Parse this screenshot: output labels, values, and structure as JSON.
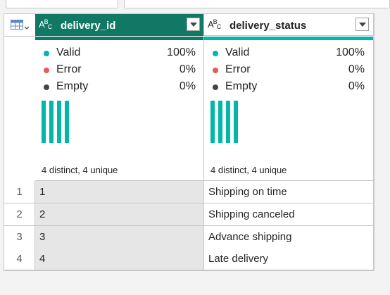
{
  "columns": [
    {
      "name": "delivery_id",
      "type_icon": "text-type-icon",
      "selected": true,
      "quality": {
        "valid_label": "Valid",
        "valid_value": "100%",
        "error_label": "Error",
        "error_value": "0%",
        "empty_label": "Empty",
        "empty_value": "0%"
      },
      "distinct_text": "4 distinct, 4 unique"
    },
    {
      "name": "delivery_status",
      "type_icon": "text-type-icon",
      "selected": false,
      "quality": {
        "valid_label": "Valid",
        "valid_value": "100%",
        "error_label": "Error",
        "error_value": "0%",
        "empty_label": "Empty",
        "empty_value": "0%"
      },
      "distinct_text": "4 distinct, 4 unique"
    }
  ],
  "rows": [
    {
      "num": "1",
      "delivery_id": "1",
      "delivery_status": "Shipping on time"
    },
    {
      "num": "2",
      "delivery_id": "2",
      "delivery_status": "Shipping canceled"
    },
    {
      "num": "3",
      "delivery_id": "3",
      "delivery_status": "Advance shipping"
    },
    {
      "num": "4",
      "delivery_id": "4",
      "delivery_status": "Late delivery"
    }
  ],
  "colors": {
    "selected_header": "#117865",
    "accent_teal": "#00b7a8",
    "valid_dot": "#00b7a8",
    "error_dot": "#e85a5a",
    "empty_dot": "#444444",
    "selected_cell": "#e6e6e6"
  },
  "icons": {
    "table_menu": "table-icon",
    "column_dropdown": "chevron-down-icon"
  }
}
